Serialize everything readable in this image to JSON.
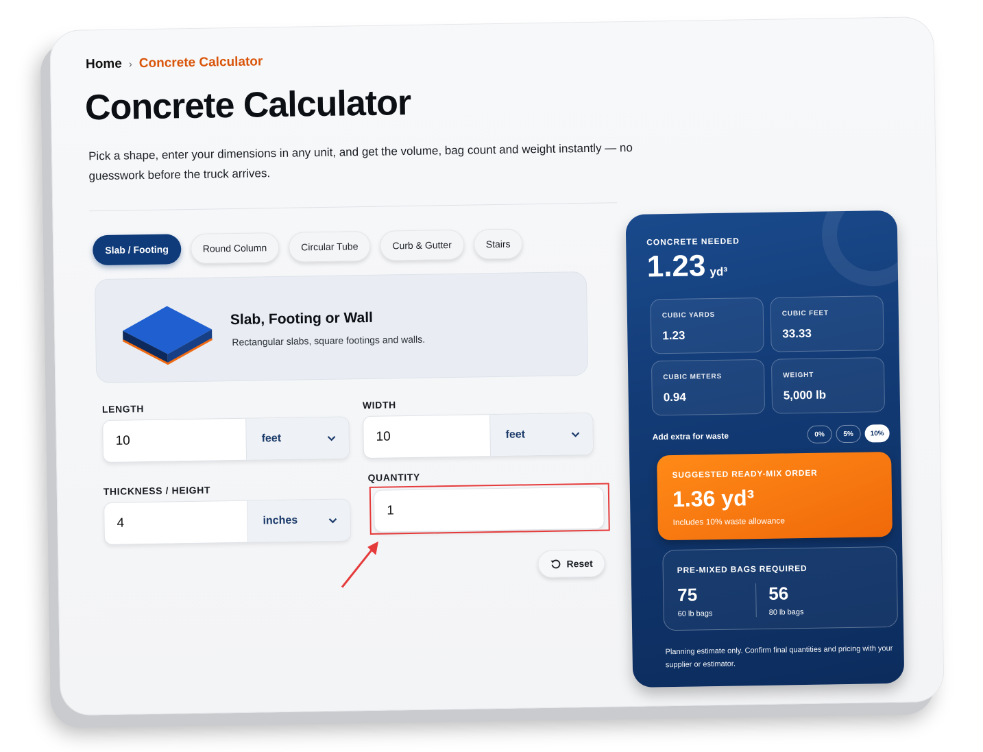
{
  "breadcrumb": {
    "home": "Home",
    "separator": "›",
    "current": "Concrete Calculator"
  },
  "title": "Concrete Calculator",
  "description": "Pick a shape, enter your dimensions in any unit, and get the volume, bag count and weight instantly — no guesswork before the truck arrives.",
  "tabs": [
    {
      "label": "Slab / Footing",
      "active": true
    },
    {
      "label": "Round Column",
      "active": false
    },
    {
      "label": "Circular Tube",
      "active": false
    },
    {
      "label": "Curb & Gutter",
      "active": false
    },
    {
      "label": "Stairs",
      "active": false
    }
  ],
  "shape": {
    "title": "Slab, Footing or Wall",
    "subtitle": "Rectangular slabs, square footings and walls.",
    "icon": "slab-icon"
  },
  "fields": {
    "length": {
      "label": "LENGTH",
      "value": "10",
      "unit": "feet"
    },
    "width": {
      "label": "WIDTH",
      "value": "10",
      "unit": "feet"
    },
    "thickness": {
      "label": "THICKNESS / HEIGHT",
      "value": "4",
      "unit": "inches"
    },
    "quantity": {
      "label": "QUANTITY",
      "value": "1"
    }
  },
  "reset_label": "Reset",
  "results": {
    "label": "CONCRETE NEEDED",
    "value": "1.23",
    "unit": "yd³",
    "stats": [
      {
        "label": "CUBIC YARDS",
        "value": "1.23"
      },
      {
        "label": "CUBIC FEET",
        "value": "33.33"
      },
      {
        "label": "CUBIC METERS",
        "value": "0.94"
      },
      {
        "label": "WEIGHT",
        "value": "5,000 lb"
      }
    ],
    "waste": {
      "label": "Add extra for waste",
      "options": [
        {
          "label": "0%",
          "active": false
        },
        {
          "label": "5%",
          "active": false
        },
        {
          "label": "10%",
          "active": true
        }
      ]
    },
    "order": {
      "label": "SUGGESTED READY-MIX ORDER",
      "value": "1.36 yd³",
      "note": "Includes 10% waste allowance"
    },
    "bags": {
      "label": "PRE-MIXED BAGS REQUIRED",
      "items": [
        {
          "count": "75",
          "unit": "60 lb bags"
        },
        {
          "count": "56",
          "unit": "80 lb bags"
        }
      ]
    },
    "disclaimer": "Planning estimate only. Confirm final quantities and pricing with your supplier or estimator."
  },
  "colors": {
    "accent": "#d9550a",
    "navy": "#0f3b7a",
    "orange": "#f07a12",
    "annotation": "#e53a3a"
  }
}
